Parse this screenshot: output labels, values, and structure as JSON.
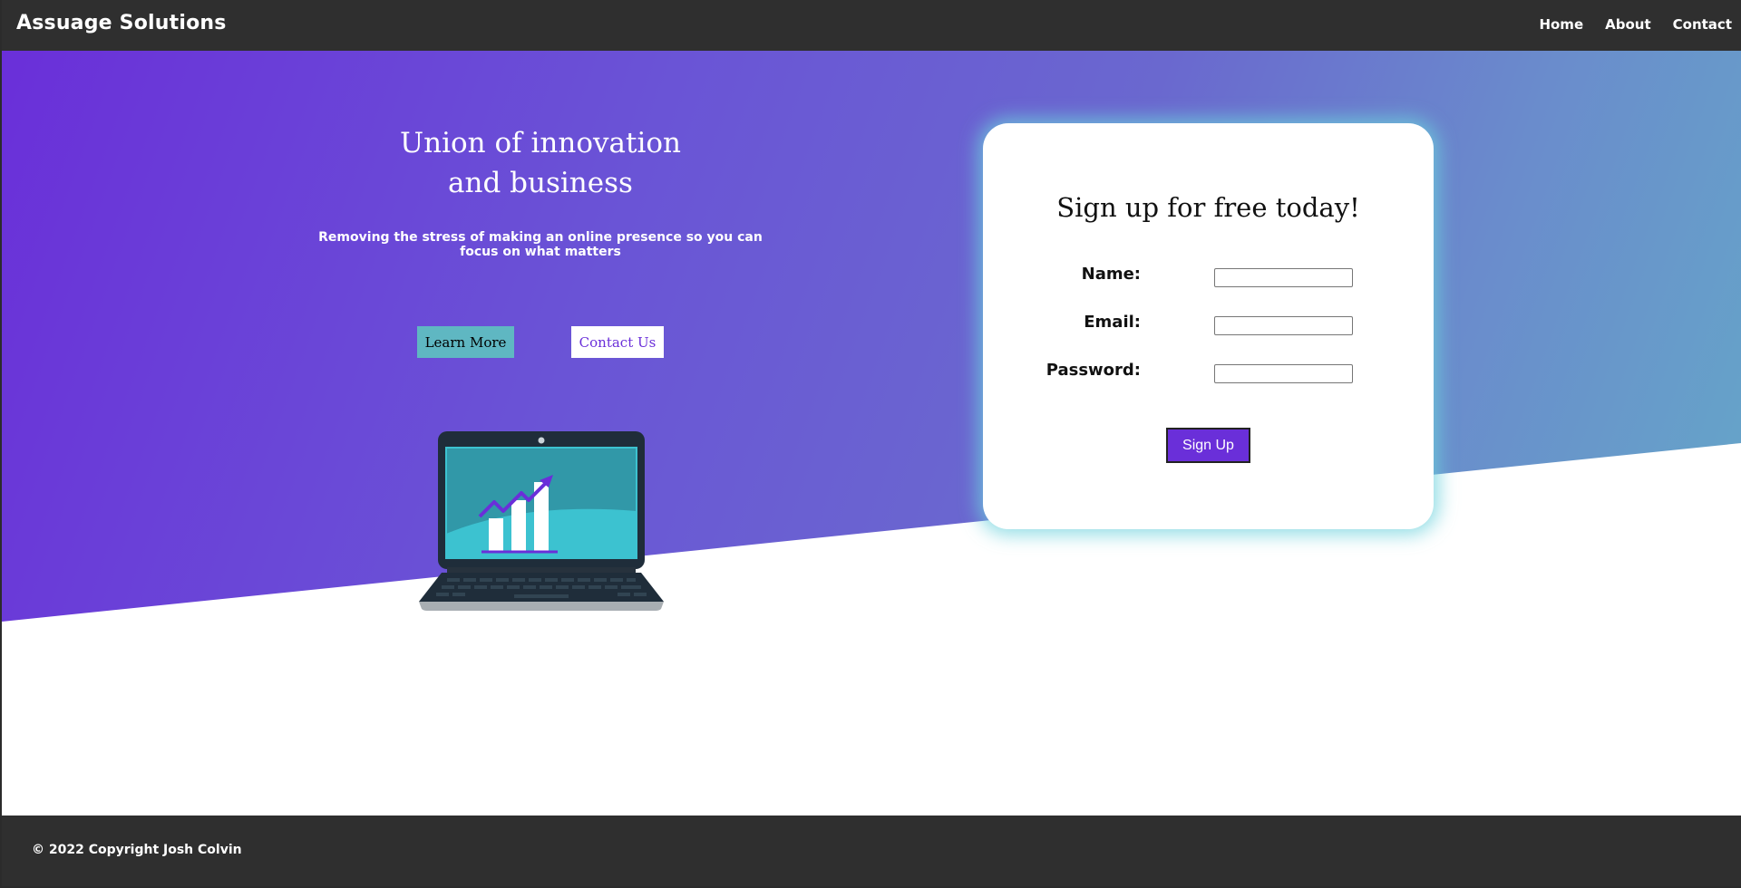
{
  "navbar": {
    "brand": "Assuage Solutions",
    "links": [
      "Home",
      "About",
      "Contact"
    ]
  },
  "hero": {
    "title_line1": "Union of innovation",
    "title_line2": "and business",
    "subtitle": "Removing the stress of making an online presence so you can focus on what matters",
    "learn_more_label": "Learn More",
    "contact_label": "Contact Us",
    "illustration": "laptop-growth-chart-icon"
  },
  "signup": {
    "title": "Sign up for free today!",
    "fields": [
      {
        "label": "Name:",
        "value": ""
      },
      {
        "label": "Email:",
        "value": ""
      },
      {
        "label": "Password:",
        "value": ""
      }
    ],
    "submit_label": "Sign Up"
  },
  "footer": {
    "text": "© 2022 Copyright Josh Colvin"
  },
  "colors": {
    "purple": "#6a2fd9",
    "teal_button": "#5fb7c2",
    "dark_bar": "#2f2f2f"
  }
}
